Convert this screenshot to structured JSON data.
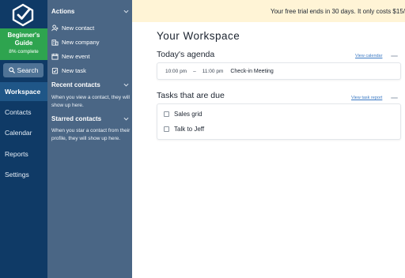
{
  "nav": {
    "guide_title": "Beginner's Guide",
    "guide_progress": "8% complete",
    "search_label": "Search",
    "items": [
      {
        "label": "Workspace",
        "active": true
      },
      {
        "label": "Contacts"
      },
      {
        "label": "Calendar"
      },
      {
        "label": "Reports"
      },
      {
        "label": "Settings"
      }
    ]
  },
  "panel": {
    "actions_title": "Actions",
    "actions": [
      {
        "label": "New contact",
        "icon": "add-contact-icon"
      },
      {
        "label": "New company",
        "icon": "company-icon"
      },
      {
        "label": "New event",
        "icon": "calendar-icon"
      },
      {
        "label": "New task",
        "icon": "task-icon"
      }
    ],
    "recent_title": "Recent contacts",
    "recent_hint": "When you view a contact, they will show up here.",
    "starred_title": "Starred contacts",
    "starred_hint": "When you star a contact from their profile, they will show up here."
  },
  "main": {
    "banner": "Your free trial ends in 30 days. It only costs $15/",
    "title": "Your Workspace",
    "agenda": {
      "title": "Today's agenda",
      "link": "View calendar",
      "events": [
        {
          "start": "10:00 pm",
          "sep": "–",
          "end": "11:00 pm",
          "title": "Check-in Meeting"
        }
      ]
    },
    "tasks": {
      "title": "Tasks that are due",
      "link": "View task report",
      "items": [
        {
          "label": "Sales grid"
        },
        {
          "label": "Talk to Jeff"
        }
      ]
    }
  },
  "colors": {
    "nav_bg": "#0f3a66",
    "panel_bg": "#4a6685",
    "guide_green": "#2ea44f",
    "banner_bg": "#fff4d6",
    "link_blue": "#3c7ac4"
  }
}
